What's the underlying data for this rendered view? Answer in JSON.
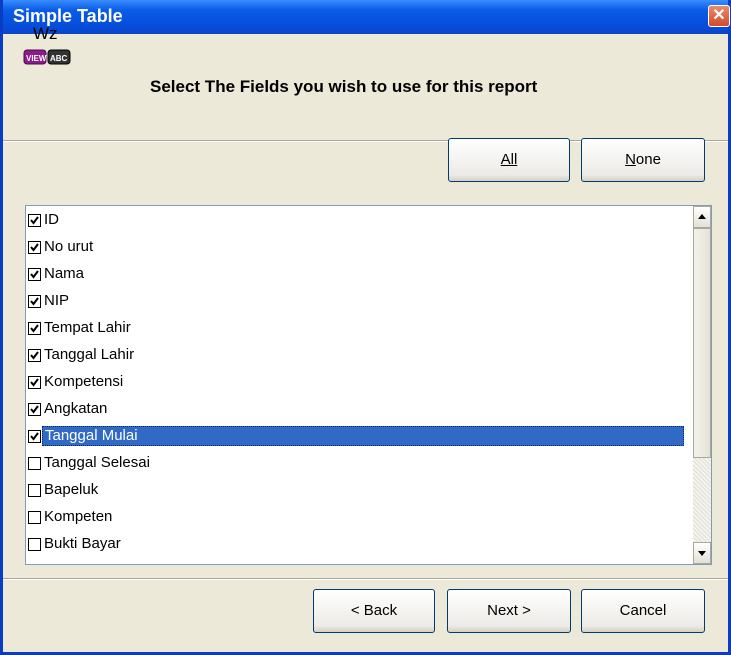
{
  "window": {
    "title": "Simple Table",
    "close_glyph": "✕"
  },
  "header": {
    "logo_text": "Wz",
    "logo_badge_left": "VIEW",
    "logo_badge_right": "ABC",
    "instruction": "Select The Fields you wish to use for this report"
  },
  "select_buttons": {
    "all_label": "All",
    "all_mnemonic": "A",
    "none_label": "None",
    "none_mnemonic": "N"
  },
  "fields": [
    {
      "label": "ID",
      "checked": true
    },
    {
      "label": "No urut",
      "checked": true
    },
    {
      "label": "Nama",
      "checked": true
    },
    {
      "label": "NIP",
      "checked": true
    },
    {
      "label": "Tempat Lahir",
      "checked": true
    },
    {
      "label": "Tanggal Lahir",
      "checked": true
    },
    {
      "label": "Kompetensi",
      "checked": true
    },
    {
      "label": "Angkatan",
      "checked": true
    },
    {
      "label": "Tanggal Mulai",
      "checked": true,
      "selected": true
    },
    {
      "label": "Tanggal Selesai",
      "checked": false
    },
    {
      "label": "Bapeluk",
      "checked": false
    },
    {
      "label": "Kompeten",
      "checked": false
    },
    {
      "label": "Bukti Bayar",
      "checked": false
    }
  ],
  "footer": {
    "back_label": "< Back",
    "next_label": "Next >",
    "cancel_label": "Cancel"
  },
  "colors": {
    "titlebar": "#0A5CE6",
    "selection": "#316AC5",
    "face": "#ECE9D8",
    "logo_left": "#8E1B8E",
    "logo_right": "#333333"
  }
}
